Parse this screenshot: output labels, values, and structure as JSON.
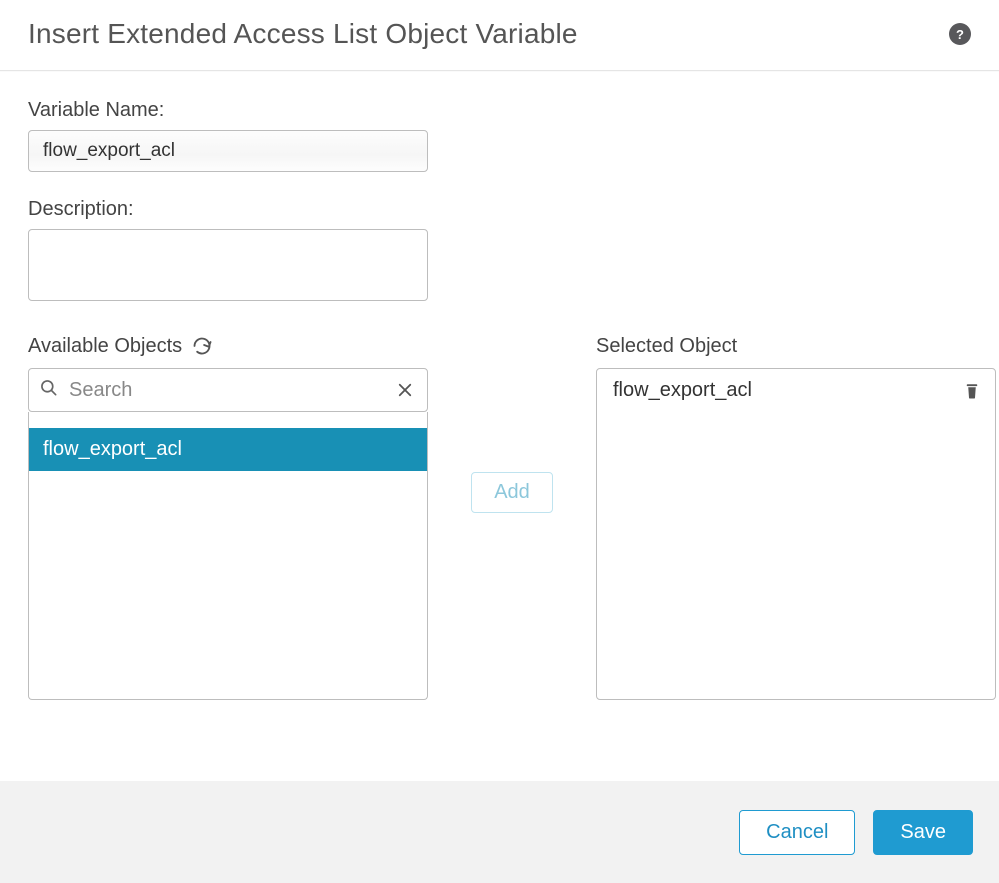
{
  "dialog": {
    "title": "Insert Extended Access List Object Variable"
  },
  "fields": {
    "variable_name_label": "Variable Name:",
    "variable_name_value": "flow_export_acl",
    "description_label": "Description:",
    "description_value": ""
  },
  "available": {
    "label": "Available Objects",
    "search_placeholder": "Search",
    "search_value": "",
    "items": [
      "flow_export_acl"
    ],
    "selected_index": 0
  },
  "transfer": {
    "add_label": "Add"
  },
  "selected": {
    "label": "Selected Object",
    "items": [
      "flow_export_acl"
    ]
  },
  "footer": {
    "cancel_label": "Cancel",
    "save_label": "Save"
  }
}
